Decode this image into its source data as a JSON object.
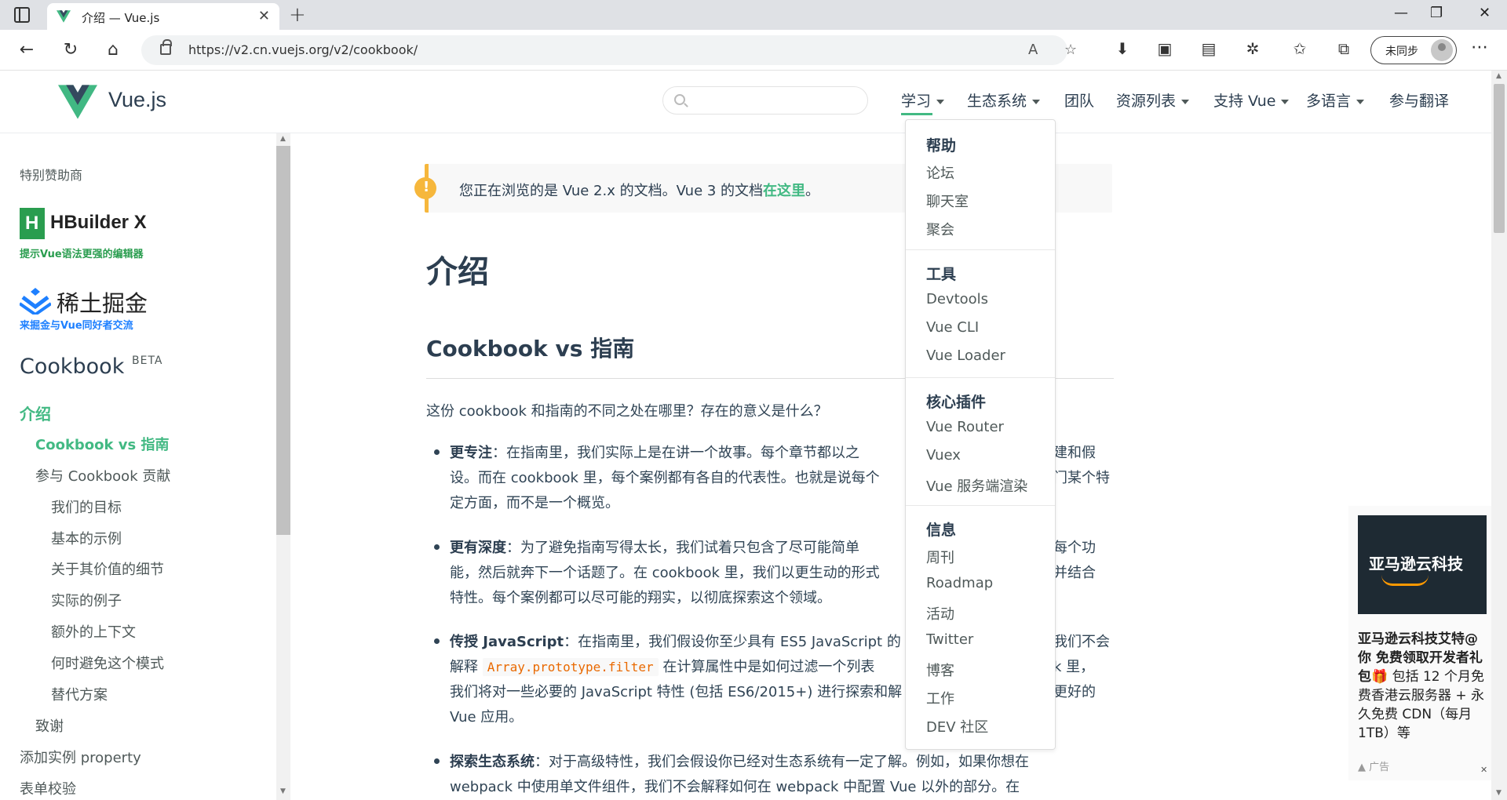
{
  "browser": {
    "tab_title": "介绍 — Vue.js",
    "url": "https://v2.cn.vuejs.org/v2/cookbook/",
    "sync_label": "未同步"
  },
  "site": {
    "logo_text": "Vue.js",
    "nav": [
      {
        "label": "学习",
        "dropdown": true
      },
      {
        "label": "生态系统",
        "dropdown": true
      },
      {
        "label": "团队",
        "dropdown": false
      },
      {
        "label": "资源列表",
        "dropdown": true
      },
      {
        "label": "支持 Vue",
        "dropdown": true
      },
      {
        "label": "多语言",
        "dropdown": true
      },
      {
        "label": "参与翻译",
        "dropdown": false
      }
    ],
    "accent_color": "#42b983"
  },
  "dropdown": {
    "groups": [
      {
        "title": "帮助",
        "items": [
          "论坛",
          "聊天室",
          "聚会"
        ]
      },
      {
        "title": "工具",
        "items": [
          "Devtools",
          "Vue CLI",
          "Vue Loader"
        ]
      },
      {
        "title": "核心插件",
        "items": [
          "Vue Router",
          "Vuex",
          "Vue 服务端渲染"
        ]
      },
      {
        "title": "信息",
        "items": [
          "周刊",
          "Roadmap",
          "活动",
          "Twitter",
          "博客",
          "工作",
          "DEV 社区"
        ]
      }
    ]
  },
  "sidebar": {
    "sponsor_label": "特别赞助商",
    "hbuilder_name": "HBuilder X",
    "hbuilder_tagline": "提示Vue语法更强的编辑器",
    "juejin_name": "稀土掘金",
    "juejin_tagline": "来掘金与Vue同好者交流",
    "title": "Cookbook",
    "beta": "BETA",
    "links": [
      {
        "label": "介绍",
        "level": 0,
        "active": true
      },
      {
        "label": "Cookbook vs 指南",
        "level": 1,
        "active": true
      },
      {
        "label": "参与 Cookbook 贡献",
        "level": 1,
        "active": false
      },
      {
        "label": "我们的目标",
        "level": 2,
        "active": false
      },
      {
        "label": "基本的示例",
        "level": 2,
        "active": false
      },
      {
        "label": "关于其价值的细节",
        "level": 2,
        "active": false
      },
      {
        "label": "实际的例子",
        "level": 2,
        "active": false
      },
      {
        "label": "额外的上下文",
        "level": 2,
        "active": false
      },
      {
        "label": "何时避免这个模式",
        "level": 2,
        "active": false
      },
      {
        "label": "替代方案",
        "level": 2,
        "active": false
      },
      {
        "label": "致谢",
        "level": 1,
        "active": false
      },
      {
        "label": "添加实例 property",
        "level": 0,
        "active": false
      },
      {
        "label": "表单校验",
        "level": 0,
        "active": false
      }
    ]
  },
  "main": {
    "notice_before": "您正在浏览的是 Vue 2.x 的文档。Vue 3 的文档",
    "notice_link": "在这里",
    "notice_after": "。",
    "h1": "介绍",
    "h2": "Cookbook vs 指南",
    "intro": "这份 cookbook 和指南的不同之处在哪里？存在的意义是什么？",
    "b1_title": "更专注",
    "b1_l1": "：在指南里，我们实际上是在讲一个故事。每个章节都以之",
    "b1_l1_tail": "建和假",
    "b1_l2": "设。而在 cookbook 里，每个案例都有各自的代表性。也就是说每个",
    "b1_l2_tail": "门某个特",
    "b1_l3": "定方面，而不是一个概览。",
    "b2_title": "更有深度",
    "b2_l1": "：为了避免指南写得太长，我们试着只包含了尽可能简单",
    "b2_l1_tail": "每个功",
    "b2_l2": "能，然后就奔下一个话题了。在 cookbook 里，我们以更生动的形式",
    "b2_l2_tail": "并结合",
    "b2_l3": "特性。每个案例都可以尽可能的翔实，以彻底探索这个领域。",
    "b3_title": "传授 JavaScript",
    "b3_l1": "：在指南里，我们假设你至少具有 ES5 JavaScript 的",
    "b3_l1_tail": "我们不会",
    "b3_l2_pre": "解释 ",
    "b3_code": "Array.prototype.filter",
    "b3_l2_post": " 在计算属性中是如何过滤一个列表",
    "b3_l2_tail": "k 里，",
    "b3_l3": "我们将对一些必要的 JavaScript 特性 (包括 ES6/2015+) 进行探索和解",
    "b3_l3_tail": "更好的",
    "b3_l4": "Vue 应用。",
    "b4_title": "探索生态系统",
    "b4_l1": "：对于高级特性，我们会假设你已经对生态系统有一定了解。例如，如果你想在",
    "b4_l2": "webpack 中使用单文件组件，我们不会解释如何在 webpack 中配置 Vue 以外的部分。在"
  },
  "ad": {
    "image_text": "亚马逊云科技",
    "headline": "亚马逊云科技艾特@你 免费领取开发者礼包🎁",
    "body": " 包括 12 个月免费香港云服务器 + 永久免费 CDN（每月1TB）等",
    "label": "广告"
  }
}
